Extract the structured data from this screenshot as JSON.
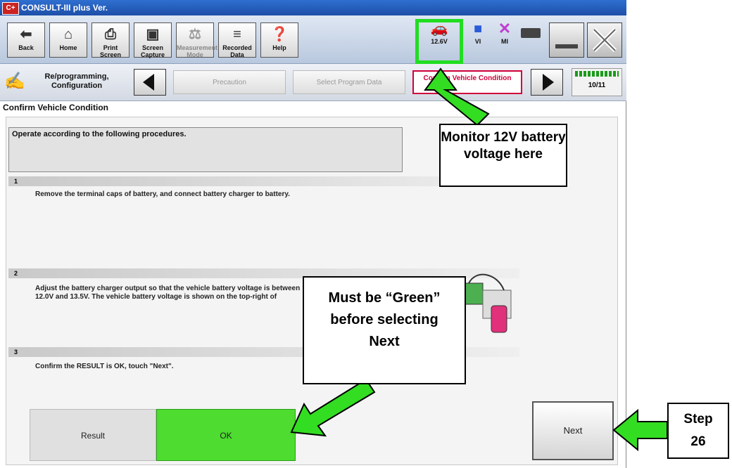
{
  "window": {
    "app_icon": "C+",
    "title": "CONSULT-III plus  Ver."
  },
  "toolbar": {
    "buttons": [
      {
        "label": "Back",
        "icon": "back-arrow-icon"
      },
      {
        "label": "Home",
        "icon": "home-icon"
      },
      {
        "label": "Print Screen",
        "icon": "printer-icon"
      },
      {
        "label": "Screen Capture",
        "icon": "camera-icon"
      },
      {
        "label": "Measurement Mode",
        "icon": "measurement-icon"
      },
      {
        "label": "Recorded Data",
        "icon": "recorded-data-icon"
      },
      {
        "label": "Help",
        "icon": "help-icon"
      }
    ],
    "status": {
      "battery_voltage": "12.6V",
      "vi": "VI",
      "mi": "MI"
    }
  },
  "nav": {
    "mode": "Re/programming, Configuration",
    "steps": [
      {
        "label": "Precaution"
      },
      {
        "label": "Select Program Data"
      },
      {
        "label": "Confirm Vehicle Condition"
      }
    ],
    "progress": "10/11"
  },
  "page_title": "Confirm Vehicle Condition",
  "instruction": "Operate according to the following procedures.",
  "procedure": [
    {
      "num": "1",
      "text": "Remove the terminal caps of battery, and connect battery charger to battery."
    },
    {
      "num": "2",
      "text": "Adjust the battery charger output so that the vehicle battery voltage is between 12.0V and 13.5V. The vehicle battery voltage is shown on the top-right of"
    },
    {
      "num": "3",
      "text": "Confirm the RESULT is OK, touch \"Next\"."
    }
  ],
  "result": {
    "label": "Result",
    "value": "OK",
    "color": "#4ddc2f"
  },
  "next_label": "Next",
  "annotations": {
    "monitor": "Monitor 12V battery voltage here",
    "green": "Must be “Green” before selecting Next",
    "step": "Step 26",
    "highlight_color": "#22dd22"
  }
}
